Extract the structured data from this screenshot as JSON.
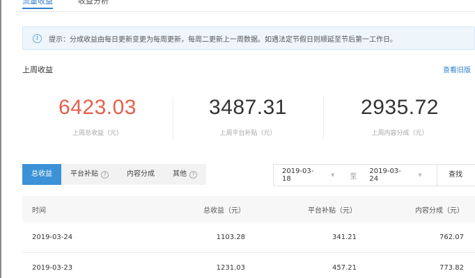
{
  "tabs": [
    {
      "label": "流量收益",
      "active": true
    },
    {
      "label": "收益分析",
      "active": false
    }
  ],
  "notice": {
    "icon": "info-icon",
    "text": "提示：分成收益由每日更新变更为每周更新，每周二更新上一周数据。如遇法定节假日则顺延至节后第一工作日。"
  },
  "section": {
    "title": "上周收益",
    "history_link": "查看旧版"
  },
  "stats": [
    {
      "value": "6423.03",
      "label": "上周总收益（元）",
      "color": "#e4604a"
    },
    {
      "value": "3487.31",
      "label": "上周平台补贴（元）",
      "color": "#333333"
    },
    {
      "value": "2935.72",
      "label": "上周内容分成（元）",
      "color": "#333333"
    }
  ],
  "filters": [
    {
      "label": "总收益",
      "active": true,
      "help": false
    },
    {
      "label": "平台补贴",
      "active": false,
      "help": true
    },
    {
      "label": "内容分成",
      "active": false,
      "help": false
    },
    {
      "label": "其他",
      "active": false,
      "help": true
    }
  ],
  "date_range": {
    "start": "2019-03-18",
    "separator": "至",
    "end": "2019-03-24",
    "search_label": "查找"
  },
  "table": {
    "columns": [
      "时间",
      "总收益（元）",
      "平台补贴（元）",
      "内容分成（元）"
    ],
    "rows": [
      [
        "2019-03-24",
        "1103.28",
        "341.21",
        "762.07"
      ],
      [
        "2019-03-23",
        "1231.03",
        "457.21",
        "773.82"
      ]
    ]
  },
  "colors": {
    "accent": "#3b92d6",
    "highlight_number": "#e4604a"
  }
}
